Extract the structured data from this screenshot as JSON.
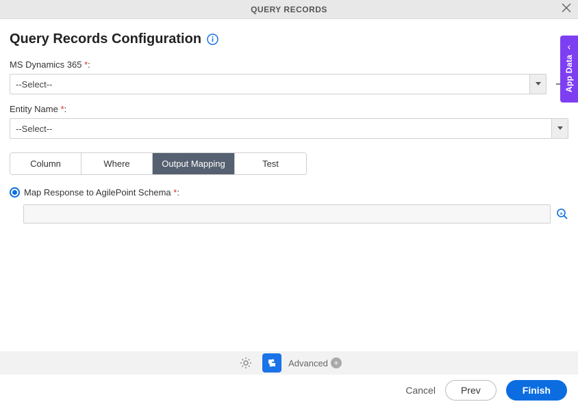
{
  "header": {
    "title": "QUERY RECORDS"
  },
  "page": {
    "title": "Query Records Configuration"
  },
  "fields": {
    "dynamics": {
      "label": "MS Dynamics 365",
      "value": "--Select--"
    },
    "entity": {
      "label": "Entity Name",
      "value": "--Select--"
    }
  },
  "tabs": {
    "column": "Column",
    "where": "Where",
    "output_mapping": "Output Mapping",
    "test": "Test"
  },
  "output_mapping": {
    "radio_label": "Map Response to AgilePoint Schema",
    "schema_value": ""
  },
  "bottom_bar": {
    "advanced": "Advanced"
  },
  "footer": {
    "cancel": "Cancel",
    "prev": "Prev",
    "finish": "Finish"
  },
  "side_panel": {
    "label": "App Data"
  }
}
